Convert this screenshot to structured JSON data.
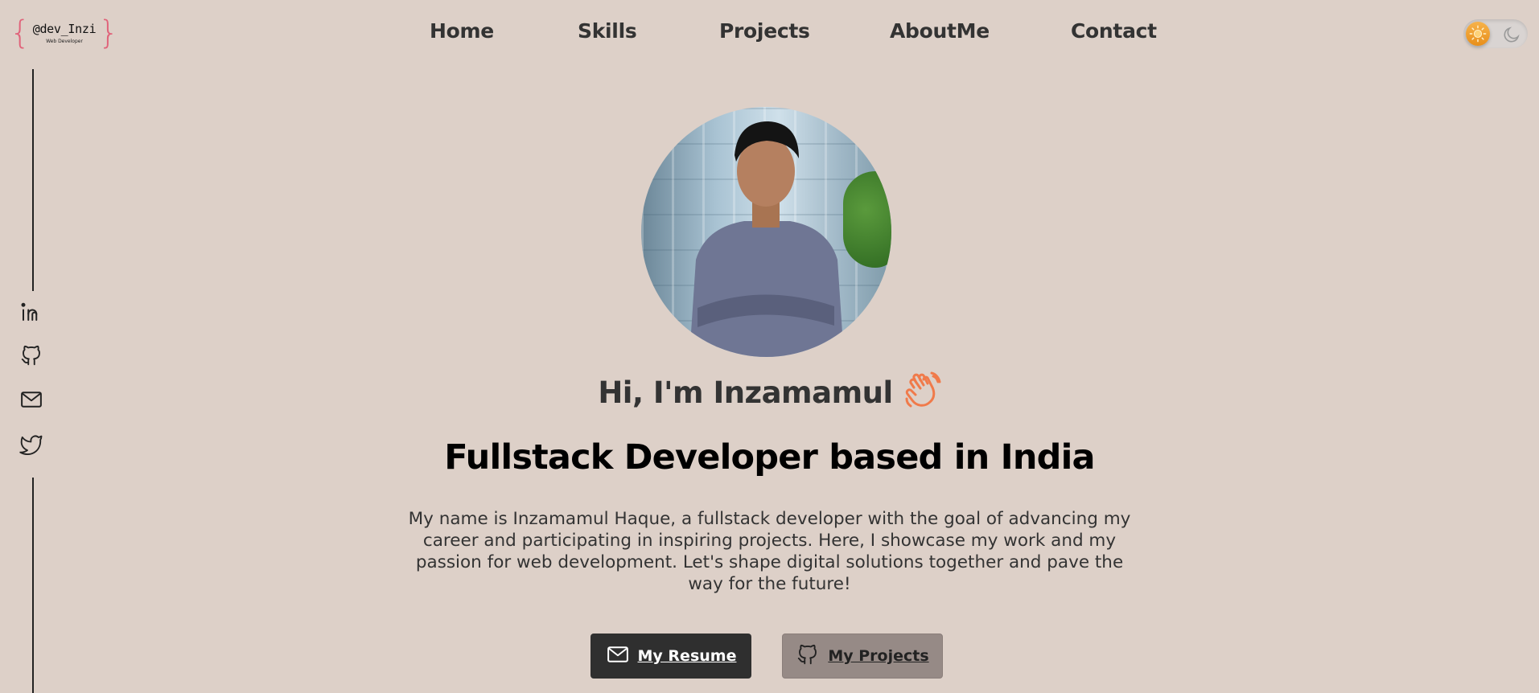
{
  "logo": {
    "name": "@dev_Inzi",
    "subtitle": "Web Developer"
  },
  "nav": {
    "items": [
      {
        "label": "Home"
      },
      {
        "label": "Skills"
      },
      {
        "label": "Projects"
      },
      {
        "label": "AboutMe"
      },
      {
        "label": "Contact"
      }
    ]
  },
  "theme_toggle": {
    "state": "light",
    "icons": [
      "sun-icon",
      "moon-icon"
    ]
  },
  "social": [
    {
      "icon": "linkedin-icon"
    },
    {
      "icon": "github-icon"
    },
    {
      "icon": "mail-icon"
    },
    {
      "icon": "twitter-icon"
    }
  ],
  "hero": {
    "greeting": "Hi, I'm Inzamamul",
    "greeting_icon": "waving-hand-icon",
    "headline": "Fullstack Developer based in India",
    "bio": "My name is Inzamamul Haque, a fullstack developer with the goal of advancing my career and participating in inspiring projects. Here, I showcase my work and my passion for web development. Let's shape digital solutions together and pave the way for the future!",
    "buttons": [
      {
        "label": "My Resume",
        "icon": "mail-icon"
      },
      {
        "label": "My Projects",
        "icon": "github-icon"
      }
    ]
  },
  "colors": {
    "background": "#ddd0c8",
    "primary_button": "#2f2f2f",
    "secondary_button": "#968a86",
    "accent": "#e0637a",
    "wave": "#f07a4a"
  }
}
